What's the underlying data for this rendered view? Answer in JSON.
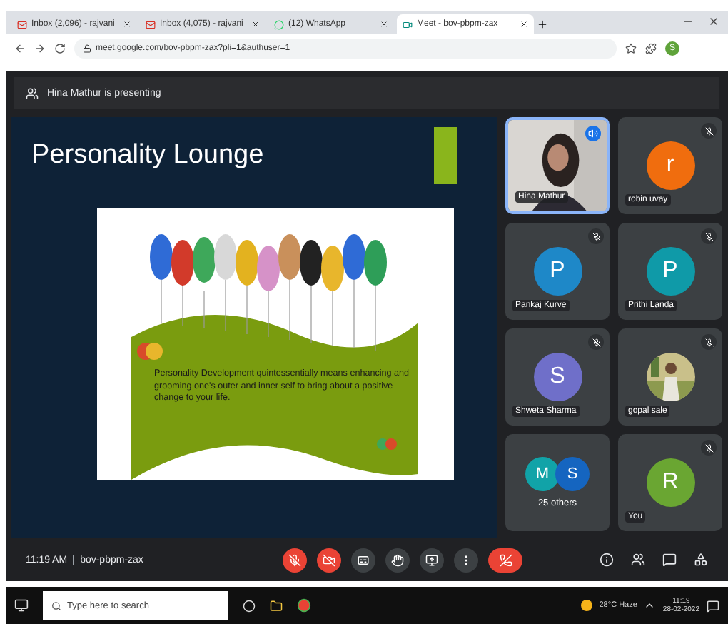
{
  "browser": {
    "tabs": [
      {
        "title": "Inbox (2,096) - rajvani",
        "kind": "mail",
        "selected": false
      },
      {
        "title": "Inbox (4,075) - rajvani",
        "kind": "mail",
        "selected": false
      },
      {
        "title": "(12) WhatsApp",
        "kind": "chat",
        "selected": false
      },
      {
        "title": "Meet - bov-pbpm-zax",
        "kind": "meet",
        "selected": true
      }
    ],
    "url": "meet.google.com/bov-pbpm-zax?pli=1&authuser=1",
    "profile_initial": "S"
  },
  "presenter_banner": "Hina Mathur is presenting",
  "slide": {
    "title": "Personality Lounge",
    "body": "Personality Development quintessentially means enhancing and  grooming one's outer and inner self to bring about a positive change to your life."
  },
  "participants": [
    {
      "kind": "video",
      "name": "Hina Mathur",
      "speaking": true
    },
    {
      "kind": "avatar",
      "name": "robin uvay",
      "initial": "r",
      "color": "#f06d0e",
      "speaking": false
    },
    {
      "kind": "avatar",
      "name": "Pankaj Kurve",
      "initial": "P",
      "color": "#1e88c8",
      "speaking": false
    },
    {
      "kind": "avatar",
      "name": "Prithi Landa",
      "initial": "P",
      "color": "#0f9aa8",
      "speaking": false
    },
    {
      "kind": "avatar",
      "name": "Shweta Sharma",
      "initial": "S",
      "color": "#6f6fc9",
      "speaking": false
    },
    {
      "name": "gopal sale",
      "speaking": false
    },
    {
      "kind": "group",
      "name": "25 others",
      "avatars": [
        {
          "initial": "M",
          "color": "#11a3a8"
        },
        {
          "initial": "S",
          "color": "#1565c0"
        }
      ]
    },
    {
      "kind": "avatar",
      "name": "You",
      "initial": "R",
      "color": "#6aa632",
      "speaking": false
    }
  ],
  "meeting": {
    "time": "11:19 AM",
    "code": "bov-pbpm-zax",
    "mic_on": false,
    "camera_on": false
  },
  "taskbar": {
    "search_placeholder": "Type here to search",
    "weather": "28°C Haze",
    "time": "11:19",
    "date": "28-02-2022"
  }
}
